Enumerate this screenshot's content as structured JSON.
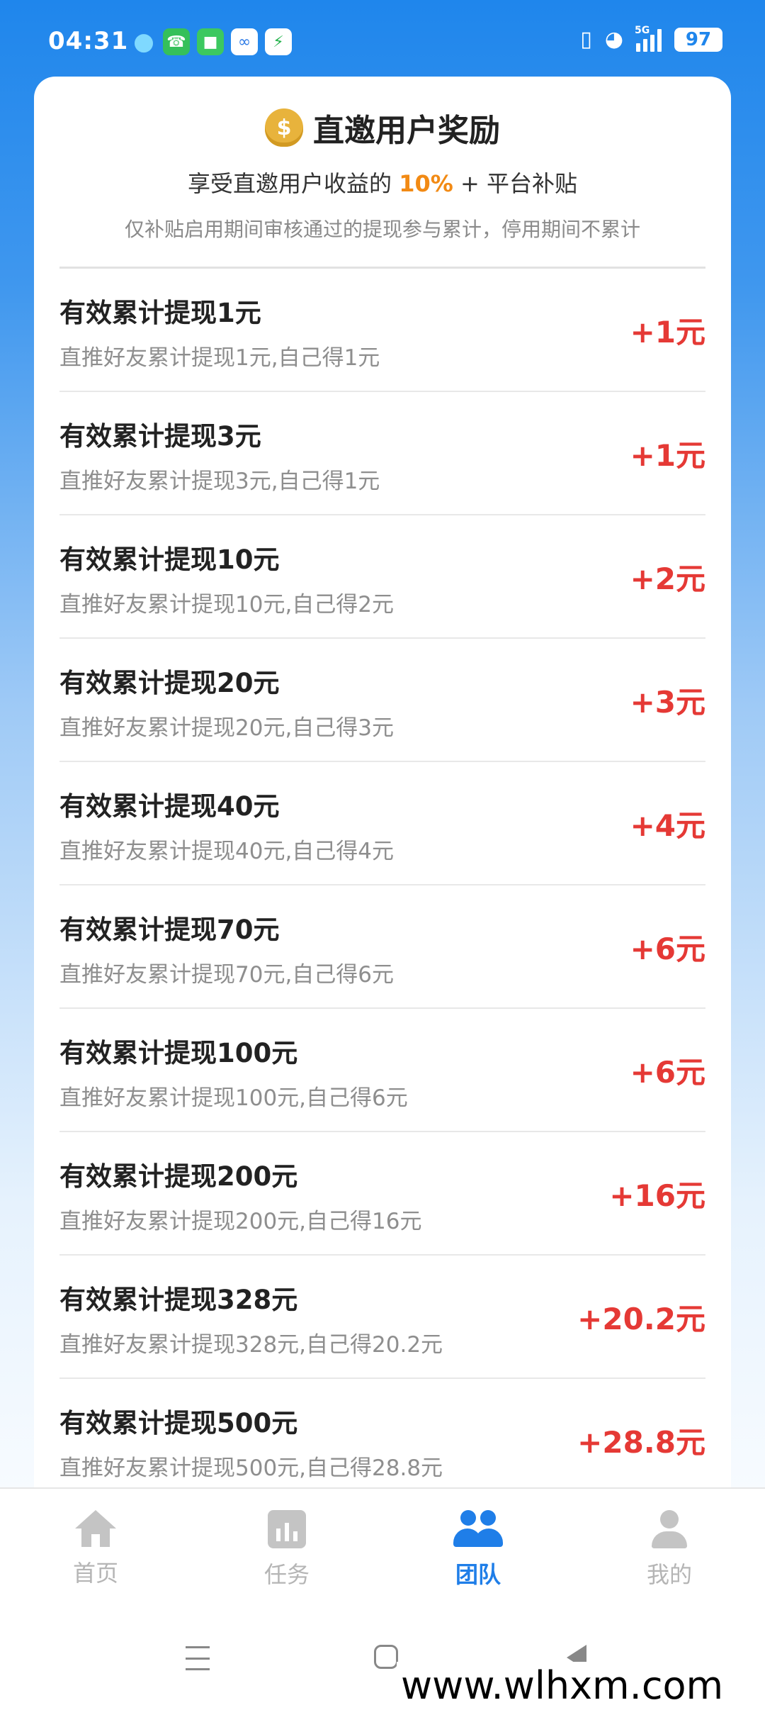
{
  "status_bar": {
    "time": "04:31",
    "network": "5G",
    "battery": "97",
    "notification_icons": [
      "qq-icon",
      "phone-icon",
      "message-icon",
      "cloud-icon",
      "shield-icon"
    ]
  },
  "header": {
    "title": "直邀用户奖励",
    "subtitle_prefix": "享受直邀用户收益的",
    "subtitle_percent": "10%",
    "subtitle_suffix": "+ 平台补贴",
    "note": "仅补贴启用期间审核通过的提现参与累计，停用期间不累计"
  },
  "rewards": [
    {
      "title": "有效累计提现1元",
      "desc": "直推好友累计提现1元,自己得1元",
      "reward": "+1元"
    },
    {
      "title": "有效累计提现3元",
      "desc": "直推好友累计提现3元,自己得1元",
      "reward": "+1元"
    },
    {
      "title": "有效累计提现10元",
      "desc": "直推好友累计提现10元,自己得2元",
      "reward": "+2元"
    },
    {
      "title": "有效累计提现20元",
      "desc": "直推好友累计提现20元,自己得3元",
      "reward": "+3元"
    },
    {
      "title": "有效累计提现40元",
      "desc": "直推好友累计提现40元,自己得4元",
      "reward": "+4元"
    },
    {
      "title": "有效累计提现70元",
      "desc": "直推好友累计提现70元,自己得6元",
      "reward": "+6元"
    },
    {
      "title": "有效累计提现100元",
      "desc": "直推好友累计提现100元,自己得6元",
      "reward": "+6元"
    },
    {
      "title": "有效累计提现200元",
      "desc": "直推好友累计提现200元,自己得16元",
      "reward": "+16元"
    },
    {
      "title": "有效累计提现328元",
      "desc": "直推好友累计提现328元,自己得20.2元",
      "reward": "+20.2元"
    },
    {
      "title": "有效累计提现500元",
      "desc": "直推好友累计提现500元,自己得28.8元",
      "reward": "+28.8元"
    }
  ],
  "tabs": [
    {
      "label": "首页",
      "icon": "home-icon",
      "active": false
    },
    {
      "label": "任务",
      "icon": "task-icon",
      "active": false
    },
    {
      "label": "团队",
      "icon": "team-icon",
      "active": true
    },
    {
      "label": "我的",
      "icon": "user-icon",
      "active": false
    }
  ],
  "watermark": "www.wlhxm.com",
  "colors": {
    "accent_blue": "#1f7ee8",
    "reward_red": "#e53935",
    "percent_orange": "#f28a14"
  }
}
